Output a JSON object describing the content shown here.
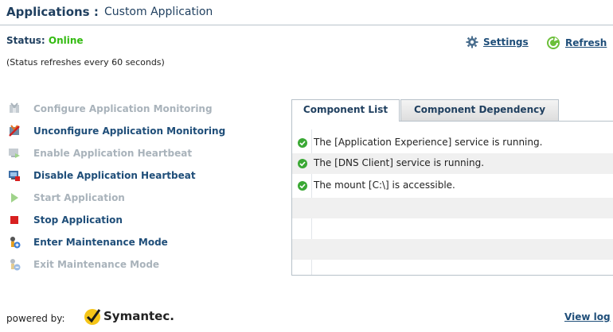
{
  "header": {
    "title": "Applications :",
    "subtitle": "Custom Application"
  },
  "status": {
    "label": "Status:",
    "value": "Online",
    "note": "(Status refreshes every 60 seconds)"
  },
  "links": {
    "settings": "Settings",
    "refresh": "Refresh",
    "view_log": "View log"
  },
  "actions": [
    {
      "label": "Configure Application Monitoring",
      "enabled": false,
      "icon": "configure-icon"
    },
    {
      "label": "Unconfigure Application Monitoring",
      "enabled": true,
      "icon": "unconfigure-icon"
    },
    {
      "label": "Enable Application Heartbeat",
      "enabled": false,
      "icon": "heartbeat-enable-icon"
    },
    {
      "label": "Disable Application Heartbeat",
      "enabled": true,
      "icon": "heartbeat-disable-icon"
    },
    {
      "label": "Start Application",
      "enabled": false,
      "icon": "play-icon"
    },
    {
      "label": "Stop Application",
      "enabled": true,
      "icon": "stop-icon"
    },
    {
      "label": "Enter Maintenance Mode",
      "enabled": true,
      "icon": "maintenance-enter-icon"
    },
    {
      "label": "Exit Maintenance Mode",
      "enabled": false,
      "icon": "maintenance-exit-icon"
    }
  ],
  "tabs": [
    {
      "label": "Component List",
      "active": true
    },
    {
      "label": "Component Dependency",
      "active": false
    }
  ],
  "components": [
    {
      "text": "The [Application Experience] service is running.",
      "status": "ok"
    },
    {
      "text": "The [DNS Client] service is running.",
      "status": "ok"
    },
    {
      "text": "The mount [C:\\] is accessible.",
      "status": "ok"
    }
  ],
  "footer": {
    "powered_by": "powered by:",
    "brand": "Symantec."
  },
  "colors": {
    "link": "#1f4e79",
    "online": "#33bb11",
    "disabled": "#a9b3bb"
  }
}
